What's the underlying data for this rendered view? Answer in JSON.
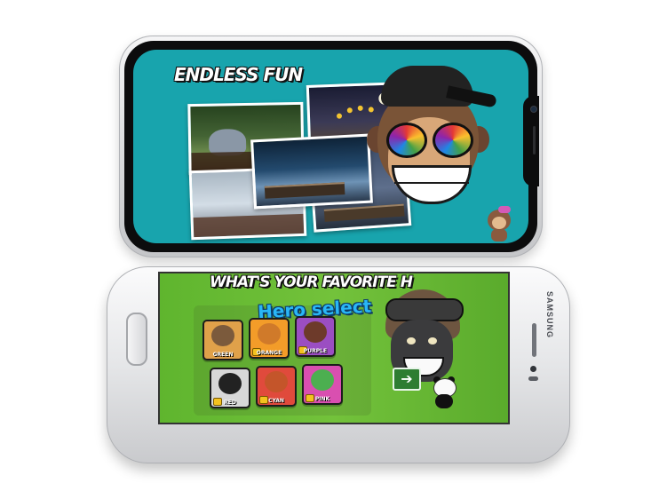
{
  "top_phone": {
    "title": "ENDLESS FUN"
  },
  "bottom_phone": {
    "title": "WHAT'S YOUR FAVORITE H",
    "brand": "SAMSUNG",
    "hero_select": {
      "title": "Hero select",
      "heroes": [
        {
          "label": "GREEN",
          "card_color": "#e0a14a",
          "face_color": "#7b5a3c",
          "locked": false
        },
        {
          "label": "ORANGE",
          "card_color": "#f39c29",
          "face_color": "#d07a2a",
          "locked": true
        },
        {
          "label": "PURPLE",
          "card_color": "#9b4ec2",
          "face_color": "#6d3a2a",
          "locked": true
        },
        {
          "label": "RED",
          "card_color": "#d8d8d8",
          "face_color": "#222222",
          "locked": true
        },
        {
          "label": "CYAN",
          "card_color": "#e04a3c",
          "face_color": "#c4552a",
          "locked": true
        },
        {
          "label": "PINK",
          "card_color": "#d94fb0",
          "face_color": "#4caf50",
          "locked": true
        }
      ],
      "next_glyph": "➔"
    }
  },
  "colors": {
    "top_screen_bg": "#18a4ad",
    "bottom_screen_bg": "#5fb52e",
    "hero_title": "#29b6f6"
  }
}
